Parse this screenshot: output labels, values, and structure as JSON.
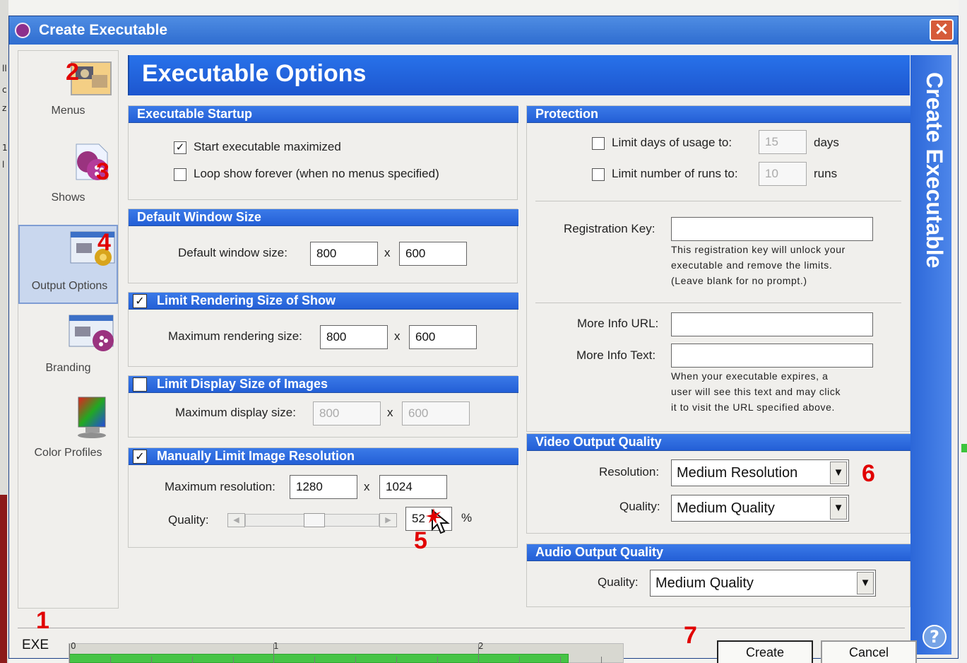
{
  "window": {
    "title": "Create Executable",
    "close_glyph": "×",
    "heading": "Executable Options",
    "vertical_title": "Create Executable",
    "help_glyph": "?"
  },
  "sidebar": {
    "items": [
      {
        "label": "Menus",
        "number": "2",
        "icon": "menus-icon"
      },
      {
        "label": "Shows",
        "number": "3",
        "icon": "shows-icon"
      },
      {
        "label": "Output Options",
        "number": "4",
        "icon": "output-options-icon",
        "selected": true
      },
      {
        "label": "Branding",
        "number": "",
        "icon": "branding-icon"
      },
      {
        "label": "Color Profiles",
        "number": "",
        "icon": "color-profiles-icon"
      }
    ]
  },
  "startup": {
    "title": "Executable Startup",
    "maximized_label": "Start executable maximized",
    "maximized_checked": "✓",
    "loop_label": "Loop show forever (when no menus specified)",
    "loop_checked": ""
  },
  "window_size": {
    "title": "Default Window Size",
    "label": "Default window size:",
    "width": "800",
    "x": "x",
    "height": "600"
  },
  "render_size": {
    "title": "Limit Rendering Size of Show",
    "checked": "✓",
    "label": "Maximum rendering size:",
    "width": "800",
    "x": "x",
    "height": "600"
  },
  "display_size": {
    "title": "Limit Display Size of Images",
    "checked": "",
    "label": "Maximum display size:",
    "width": "800",
    "x": "x",
    "height": "600"
  },
  "image_resolution": {
    "title": "Manually Limit Image Resolution",
    "checked": "✓",
    "label": "Maximum resolution:",
    "width": "1280",
    "x": "x",
    "height": "1024",
    "quality_label": "Quality:",
    "quality_value": "52",
    "quality_percent": "%",
    "quality_level": 0.52
  },
  "protection": {
    "title": "Protection",
    "days_label": "Limit days of usage to:",
    "days_value": "15",
    "days_unit": "days",
    "days_checked": "",
    "runs_label": "Limit number of runs to:",
    "runs_value": "10",
    "runs_unit": "runs",
    "runs_checked": "",
    "registration_label": "Registration Key:",
    "registration_value": "",
    "registration_note_1": "This registration key will unlock your",
    "registration_note_2": "executable and remove the limits.",
    "registration_note_3": "(Leave blank for no prompt.)",
    "url_label": "More Info URL:",
    "url_value": "",
    "text_label": "More Info Text:",
    "text_value": "",
    "expires_note_1": "When your executable expires, a",
    "expires_note_2": "user will see this text and may click",
    "expires_note_3": "it to visit the URL specified above."
  },
  "video": {
    "title": "Video Output Quality",
    "resolution_label": "Resolution:",
    "resolution_value": "Medium Resolution",
    "quality_label": "Quality:",
    "quality_value": "Medium Quality"
  },
  "audio": {
    "title": "Audio Output Quality",
    "quality_label": "Quality:",
    "quality_value": "Medium Quality"
  },
  "timeline": {
    "label": "EXE",
    "ticks": [
      "0",
      "1",
      "2"
    ],
    "progress": 0.9
  },
  "buttons": {
    "create": "Create",
    "cancel": "Cancel"
  },
  "annotations": {
    "one": "1",
    "five": "5",
    "six": "6",
    "seven": "7"
  },
  "outside": {
    "marks": [
      "ll",
      "c",
      "z",
      "1",
      "l"
    ]
  },
  "colors": {
    "title_blue": "#2f6dd0",
    "section_blue": "#245fd6",
    "red_annotation": "#e10000",
    "timeline_green": "#46c446"
  }
}
